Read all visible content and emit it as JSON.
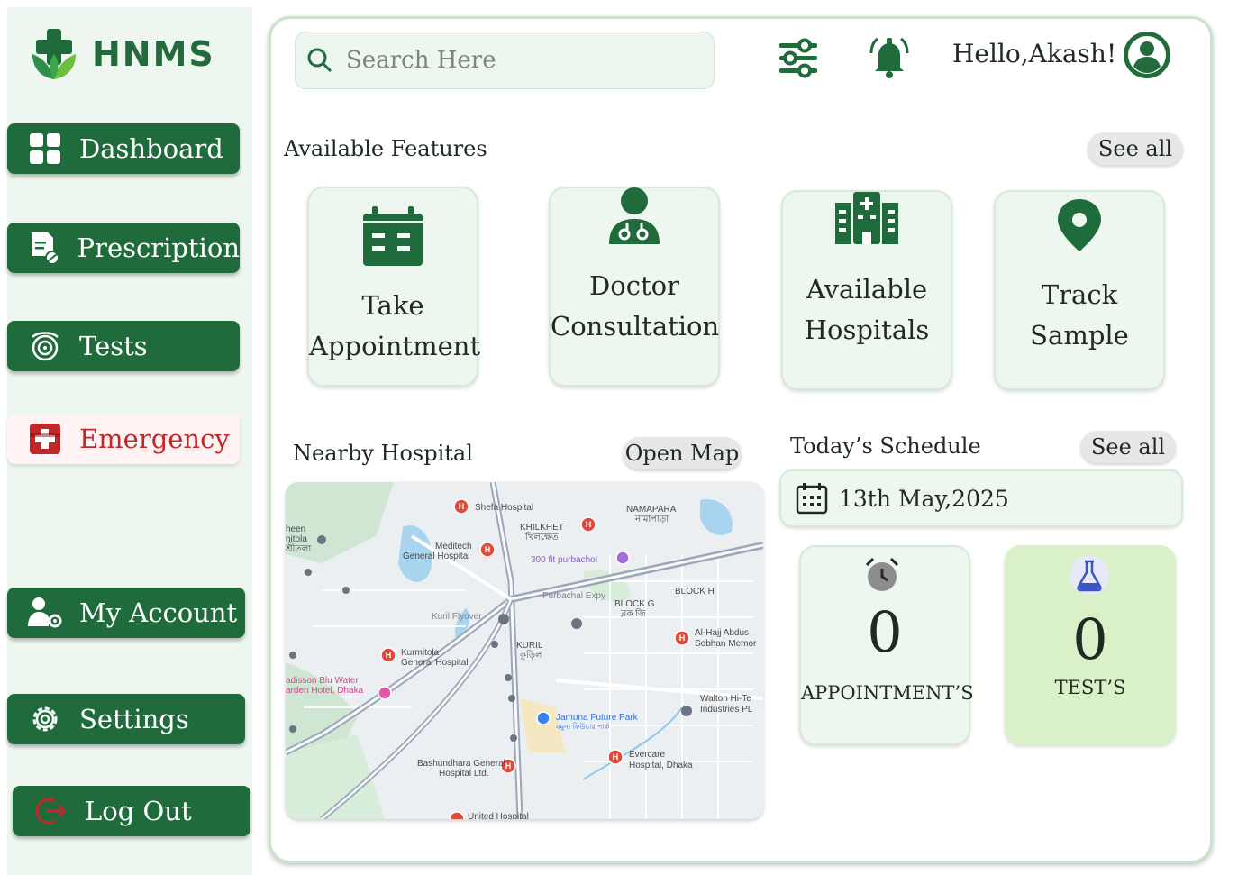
{
  "app": {
    "name": "HNMS"
  },
  "sidebar": {
    "items": [
      {
        "label": "Dashboard",
        "icon": "dashboard-grid-icon"
      },
      {
        "label": "Prescription",
        "icon": "prescription-icon"
      },
      {
        "label": "Tests",
        "icon": "tests-icon"
      },
      {
        "label": "Emergency",
        "icon": "emergency-icon"
      },
      {
        "label": "My Account",
        "icon": "user-gear-icon"
      },
      {
        "label": "Settings",
        "icon": "gear-icon"
      },
      {
        "label": "Log Out",
        "icon": "logout-icon"
      }
    ]
  },
  "header": {
    "search_placeholder": "Search Here",
    "greeting": "Hello,Akash!",
    "icons": [
      "filter-sliders-icon",
      "notification-bell-icon",
      "user-avatar-icon"
    ]
  },
  "features": {
    "title": "Available Features",
    "see_all": "See all",
    "items": [
      {
        "line1": "Take",
        "line2": "Appointment",
        "icon": "calendar-icon"
      },
      {
        "line1": "Doctor",
        "line2": "Consultation",
        "icon": "doctor-icon"
      },
      {
        "line1": "Available",
        "line2": "Hospitals",
        "icon": "hospital-building-icon"
      },
      {
        "line1": "Track",
        "line2": "Sample",
        "icon": "location-pin-icon"
      }
    ]
  },
  "nearby": {
    "title": "Nearby Hospital",
    "open_map": "Open Map",
    "map_labels": {
      "shefa": "Shefa Hospital",
      "namapara": "NAMAPARA",
      "namapara_bn": "নামাপাড়া",
      "khilkhet": "KHILKHET",
      "khilkhet_bn": "খিলক্ষেত",
      "meditech": "Meditech",
      "meditech2": "General Hospital",
      "purbachol": "300 fit purbachol",
      "purbachal_exp": "Purbachal Expy",
      "block_g": "BLOCK G",
      "block_g_bn": "ব্লক জি",
      "block_h": "BLOCK H",
      "kuril_flyover": "Kuril Flyover",
      "kuril": "KURIL",
      "kuril_bn": "কুড়িল",
      "alhajj": "Al-Hajj Abdus",
      "alhajj2": "Sobhan Memor",
      "kurmitola": "Kurmitola",
      "kurmitola2": "General Hospital",
      "radisson": "adisson Blu Water",
      "radisson2": "arden Hotel, Dhaka",
      "walton": "Walton Hi-Te",
      "walton2": "Industries PL",
      "jamuna": "Jamuna Future Park",
      "jamuna_bn": "যমুনা ফিউচার পার্ক",
      "evercare": "Evercare",
      "evercare2": "Hospital, Dhaka",
      "bashundhara": "Bashundhara General",
      "bashundhara2": "Hospital Ltd.",
      "united": "United Hospital",
      "heen": "heen",
      "nitola": "nitola",
      "nitola_bn": "শ্রীতলা"
    }
  },
  "schedule": {
    "title": "Today’s Schedule",
    "see_all": "See all",
    "date": "13th May,2025",
    "appointments": {
      "count": "0",
      "label": "APPOINTMENT’S",
      "icon": "alarm-clock-icon"
    },
    "tests": {
      "count": "0",
      "label": "TEST’S",
      "icon": "flask-icon"
    }
  },
  "colors": {
    "primary_green": "#1f6b3b",
    "light_green_bg": "#eef7ef",
    "emergency_red": "#c0292a",
    "test_card_bg": "#d9f0c9"
  }
}
